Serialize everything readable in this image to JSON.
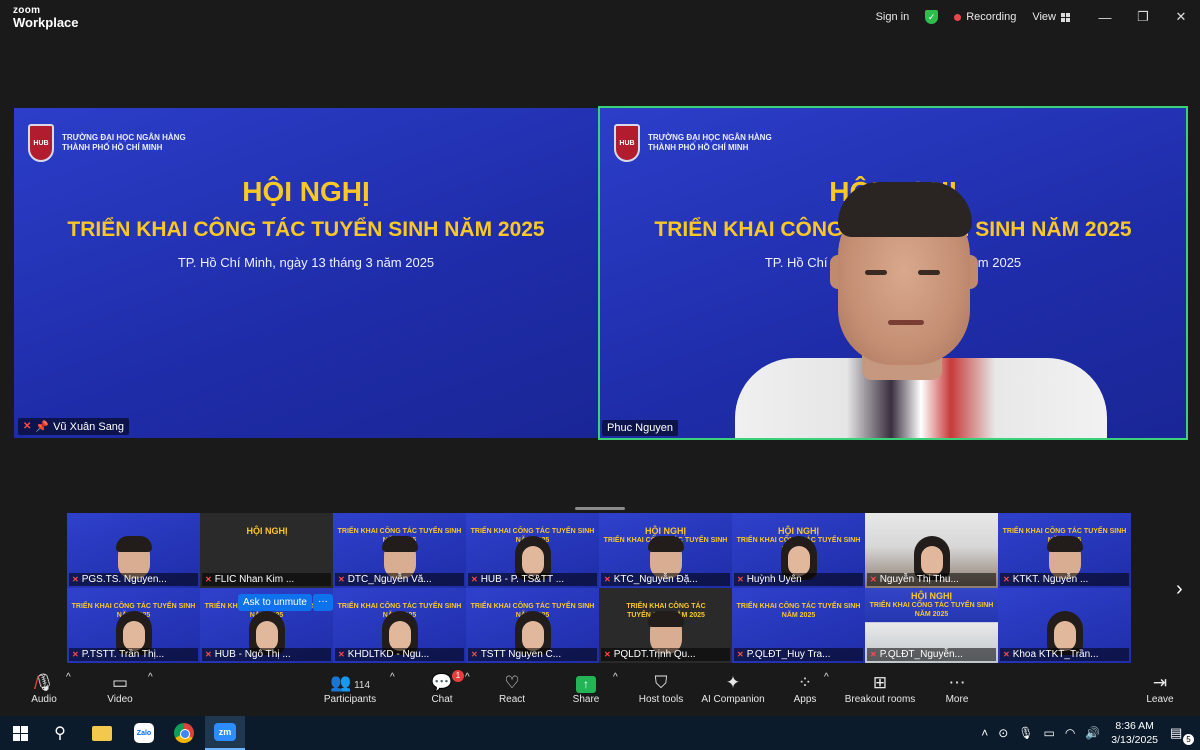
{
  "app": {
    "logo_line1": "zoom",
    "logo_line2": "Workplace"
  },
  "titlebar": {
    "sign_in": "Sign in",
    "recording": "Recording",
    "view": "View"
  },
  "slide": {
    "school_line1": "TRƯỜNG ĐẠI HỌC NGÂN HÀNG",
    "school_line2": "THÀNH PHỐ HỒ CHÍ MINH",
    "logo_text": "HUB",
    "title": "HỘI NGHỊ",
    "subtitle": "TRIỂN KHAI CÔNG TÁC TUYỂN SINH NĂM 2025",
    "date": "TP. Hồ Chí Minh, ngày 13 tháng 3 năm 2025"
  },
  "main_tiles": [
    {
      "name": "Vũ Xuân Sang"
    },
    {
      "name": "Phuc Nguyen"
    }
  ],
  "gallery": {
    "mini_title": "HỘI NGHỊ",
    "mini_sub": "TRIỂN KHAI CÔNG TÁC TUYỂN SINH NĂM 2025",
    "ask_unmute": "Ask to unmute",
    "more": "···",
    "row1": [
      "PGS.TS. Nguyen...",
      "FLIC Nhan Kim ...",
      "DTC_Nguyễn Vă...",
      "HUB - P. TS&TT ...",
      "KTC_Nguyễn Đặ...",
      "Huỳnh Uyên",
      "Nguyễn Thị Thu...",
      "KTKT. Nguyễn ..."
    ],
    "row2": [
      "P.TSTT. Trần Thị...",
      "HUB - Ngô Thị ...",
      "KHDLTKD - Ngu...",
      "TSTT Nguyen C...",
      "PQLDT.Trịnh Qu...",
      "P.QLĐT_Huy Tra...",
      "P.QLĐT_Nguyễn...",
      "Khoa KTKT_Trần..."
    ]
  },
  "toolbar": {
    "audio": "Audio",
    "video": "Video",
    "participants": "Participants",
    "participants_count": "114",
    "chat": "Chat",
    "chat_badge": "1",
    "react": "React",
    "share": "Share",
    "host_tools": "Host tools",
    "ai_companion": "AI Companion",
    "apps": "Apps",
    "breakout_rooms": "Breakout rooms",
    "more": "More",
    "leave": "Leave"
  },
  "taskbar": {
    "zalo": "Zalo",
    "zoom": "zm",
    "time": "8:36 AM",
    "date": "3/13/2025",
    "notifications": "5"
  },
  "colors": {
    "active_border": "#3ad17a",
    "slide_bg": "#2c3ec9",
    "slide_title": "#f9c825",
    "recording_dot": "#e94848",
    "share_green": "#22b455",
    "leave_red": "#e53e3e"
  }
}
